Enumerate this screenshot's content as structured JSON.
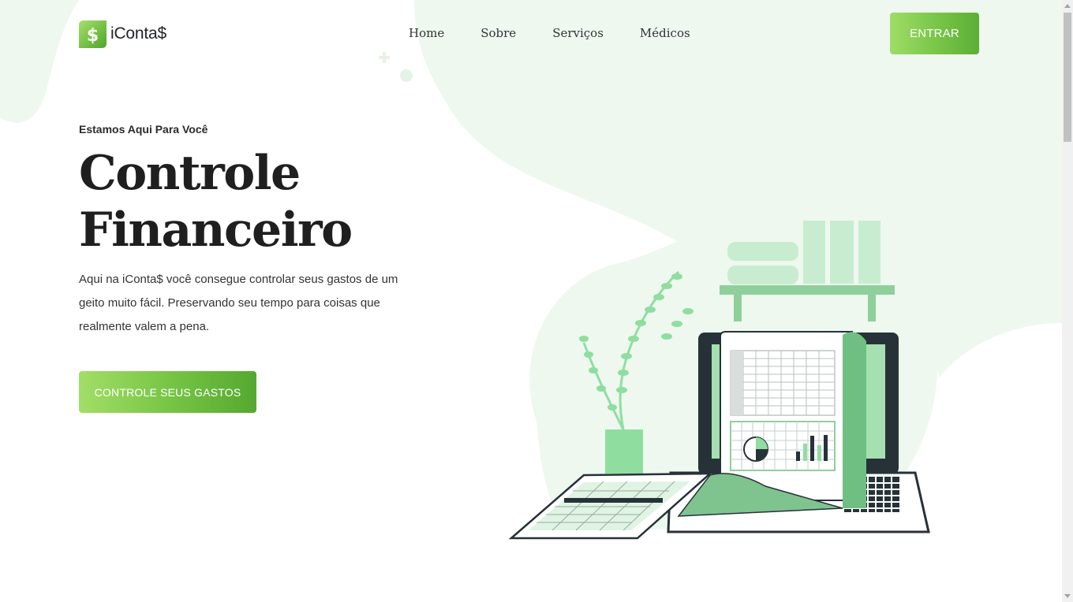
{
  "brand": {
    "name": "iConta$",
    "icon": "dollar-leaf-icon"
  },
  "nav": {
    "items": [
      "Home",
      "Sobre",
      "Serviços",
      "Médicos"
    ]
  },
  "header": {
    "login_label": "ENTRAR"
  },
  "hero": {
    "eyebrow": "Estamos Aqui Para Você",
    "title_line1": "Controle",
    "title_line2": "Financeiro",
    "description": "Aqui na iConta$ você consegue controlar seus gastos de um geito muito fácil. Preservando seu tempo para coisas que realmente valem a pena.",
    "cta_label": "CONTROLE SEUS GASTOS"
  },
  "colors": {
    "accent_start": "#9fdc66",
    "accent_end": "#55a82f",
    "blob": "#eef8ef",
    "illustration_green": "#8fdea0",
    "dark": "#263238"
  },
  "illustration": {
    "name": "financial-spreadsheet-illustration"
  }
}
